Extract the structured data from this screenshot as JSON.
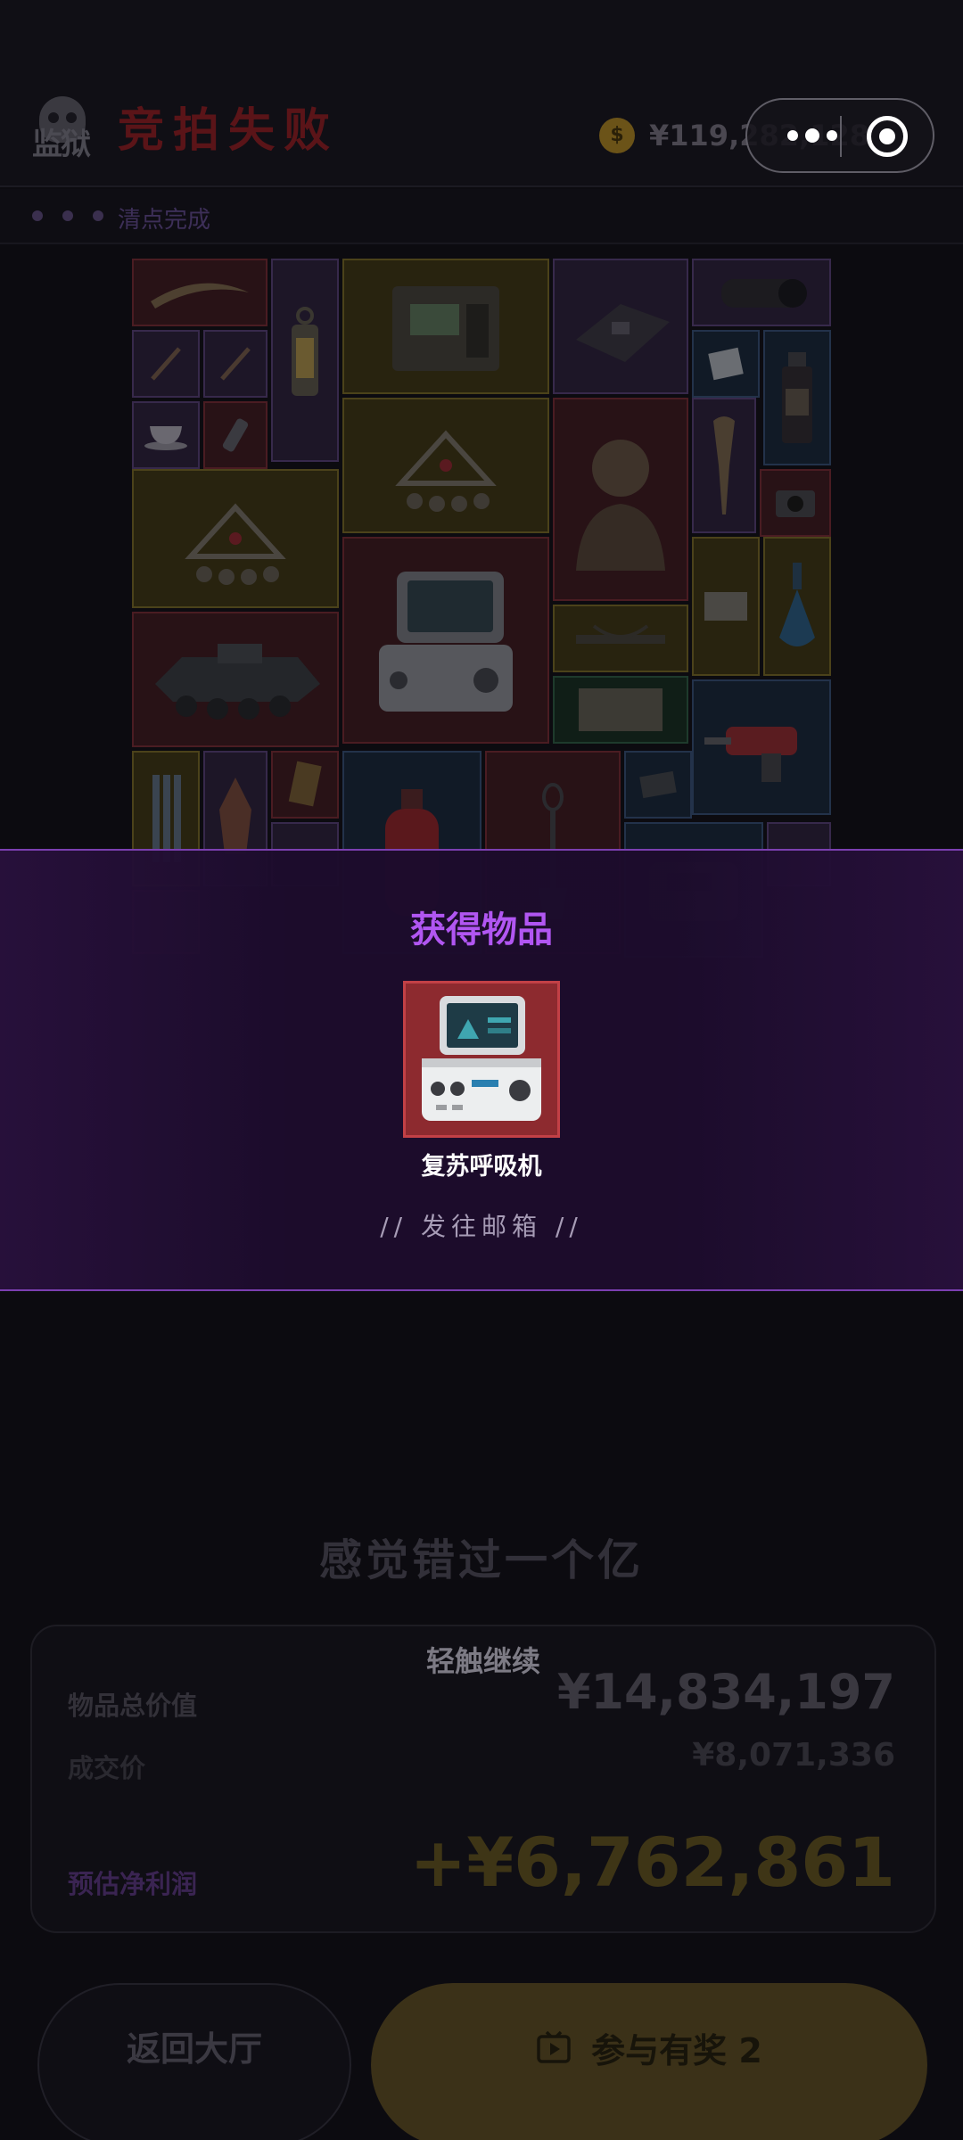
{
  "header": {
    "logo_text": "监狱",
    "title": "竞拍失败",
    "coin_symbol": "$",
    "balance": "¥119,282,128",
    "progress_text": "清点完成"
  },
  "modal": {
    "title": "获得物品",
    "item_name": "复苏呼吸机",
    "mailbox_text": "// 发往邮箱 //"
  },
  "result": {
    "missed_text": "感觉错过一个亿",
    "tap_continue": "轻触继续",
    "total_label": "物品总价值",
    "total_value": "¥14,834,197",
    "deal_label": "成交价",
    "deal_value": "¥8,071,336",
    "profit_label": "预估净利润",
    "profit_value": "+¥6,762,861"
  },
  "buttons": {
    "lobby": "返回大厅",
    "join": "参与有奖 2"
  },
  "colors": {
    "accent_purple": "#b156f2",
    "fail_red": "#5a1418",
    "gold": "#3e3516"
  }
}
